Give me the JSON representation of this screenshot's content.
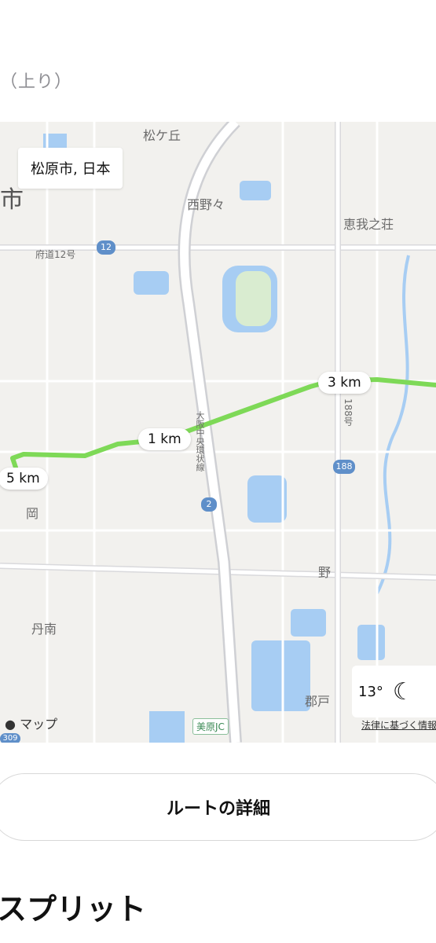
{
  "header": {
    "subtitle": "（上り）"
  },
  "map": {
    "location_chip": "松原市, 日本",
    "places": {
      "matsugaoka": "松ケ丘",
      "shi": "市",
      "nishinono": "西野々",
      "egashisou": "恵我之荘",
      "fudou12": "府道12号",
      "oka": "岡",
      "tannan": "丹南",
      "no": "野",
      "gouto": "郡戸",
      "route188": "188号",
      "loop_road": "大阪中央環状線"
    },
    "shields": {
      "s12": "12",
      "s2": "2",
      "s188": "188",
      "s309": "309"
    },
    "km_markers": [
      "5 km",
      "1 km",
      "3 km"
    ],
    "jc_label": "美原JC",
    "brand": "マップ",
    "weather": {
      "temp": "13°",
      "icon": "moon-stars-icon"
    },
    "legal": "法律に基づく情報",
    "route_color": "#7ed957"
  },
  "route_details_button": "ルートの詳細",
  "splits_title": "スプリット"
}
